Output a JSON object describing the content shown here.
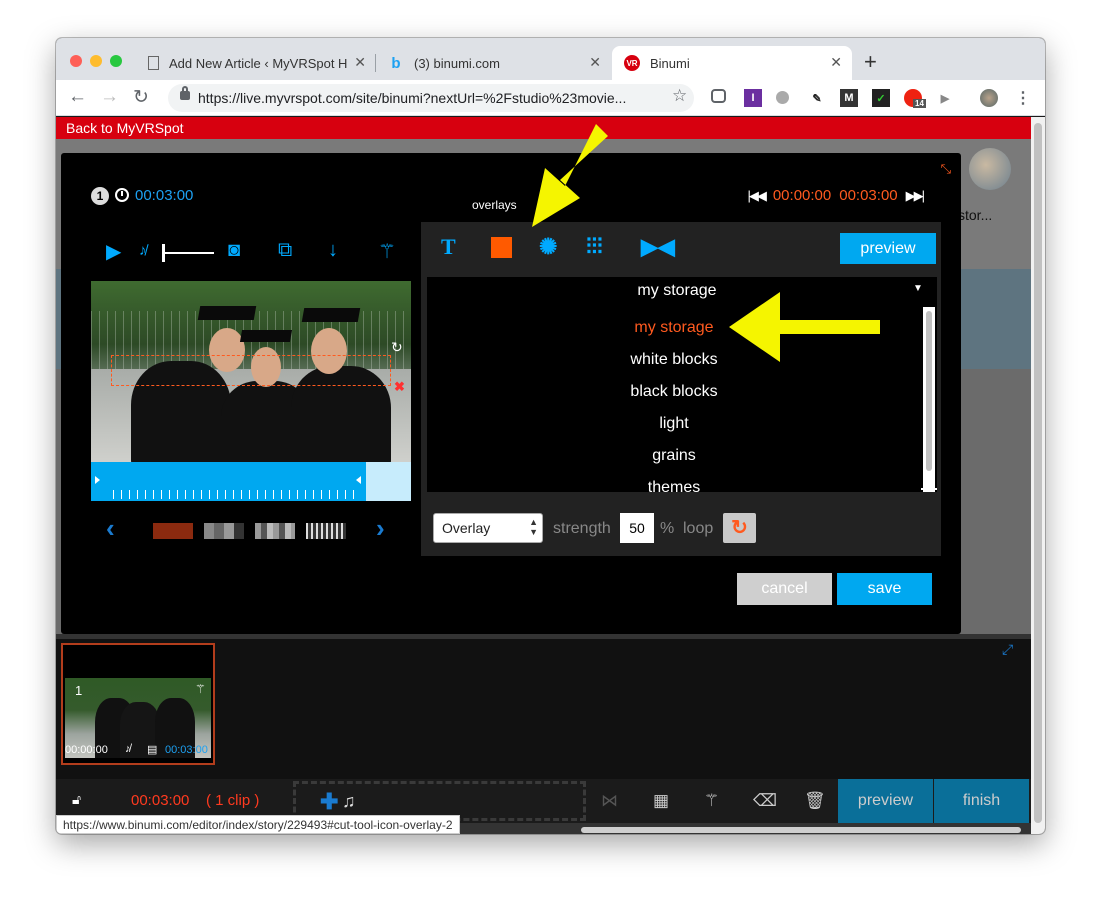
{
  "browser": {
    "tabs": [
      {
        "title": "Add New Article ‹ MyVRSpot H",
        "icon": "document-icon"
      },
      {
        "title": "(3) binumi.com",
        "icon": "binumi-b-icon"
      },
      {
        "title": "Binumi",
        "icon": "vr-icon"
      }
    ],
    "url": "https://live.myvrspot.com/site/binumi?nextUrl=%2Fstudio%23movie...",
    "ext_badge": "14"
  },
  "page": {
    "back_link": "Back to MyVRSpot",
    "bg_text": "stor..."
  },
  "editor": {
    "clip_number": "1",
    "duration": "00:03:00",
    "range_start": "00:00:00",
    "range_end": "00:03:00",
    "tooltip": "overlays",
    "preview_label": "preview",
    "dropdown_header": "my storage",
    "options": [
      "my storage",
      "white blocks",
      "black blocks",
      "light",
      "grains",
      "themes"
    ],
    "selected_option": "my storage",
    "blend_mode": "Overlay",
    "strength_label": "strength",
    "strength_value": "50",
    "percent": "%",
    "loop_label": "loop",
    "cancel_label": "cancel",
    "save_label": "save"
  },
  "timeline": {
    "clip_number": "1",
    "clip_start": "00:00:00",
    "clip_end": "00:03:00",
    "total_time": "00:03:00",
    "clip_count": "( 1 clip )",
    "preview_label": "preview",
    "finish_label": "finish"
  },
  "status_url": "https://www.binumi.com/editor/index/story/229493#cut-tool-icon-overlay-2",
  "colors": {
    "accent_blue": "#00a8f0",
    "accent_orange": "#ff5a1f",
    "brand_red": "#d7000f",
    "arrow_yellow": "#f5f500"
  }
}
